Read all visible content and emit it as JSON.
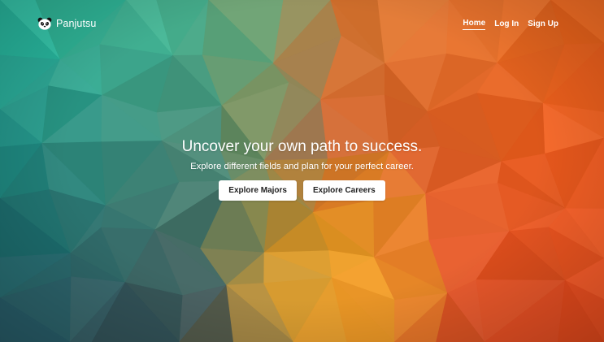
{
  "brand": {
    "name": "Panjutsu",
    "icon": "panda-icon"
  },
  "nav": {
    "items": [
      {
        "label": "Home",
        "active": true
      },
      {
        "label": "Log In",
        "active": false
      },
      {
        "label": "Sign Up",
        "active": false
      }
    ]
  },
  "hero": {
    "title": "Uncover your own path to success.",
    "subtitle": "Explore different fields and plan for your perfect career.",
    "buttons": [
      {
        "label": "Explore Majors"
      },
      {
        "label": "Explore Careers"
      }
    ],
    "background": "low-poly gradient teal to orange",
    "colors": {
      "teal": "#2fb89f",
      "dark_teal": "#1f4d63",
      "olive": "#8a9a4a",
      "orange": "#f07a22",
      "red_orange": "#f04a25",
      "yellow": "#f5b020"
    }
  }
}
